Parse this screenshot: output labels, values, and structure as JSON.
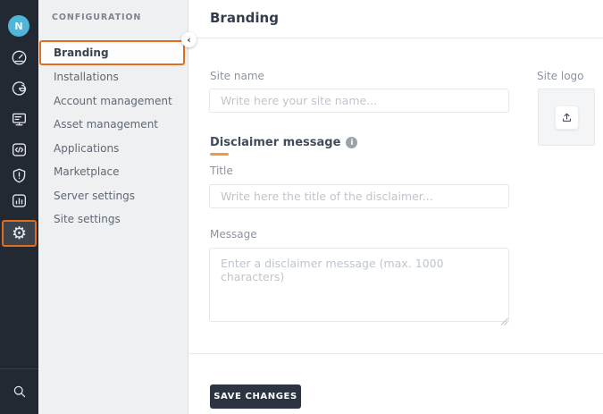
{
  "iconbar": {
    "avatar_label": "N",
    "icons": [
      {
        "name": "dashboard-gauge-icon"
      },
      {
        "name": "spiral-g-icon"
      },
      {
        "name": "monitoring-screen-icon"
      },
      {
        "name": "code-icon"
      },
      {
        "name": "security-shield-icon"
      },
      {
        "name": "reports-chart-icon"
      },
      {
        "name": "settings-gear-icon",
        "selected": true
      },
      {
        "name": "search-icon"
      }
    ],
    "gear_glyph": "⚙"
  },
  "sidebar": {
    "section_title": "CONFIGURATION",
    "collapse_glyph": "‹",
    "items": [
      {
        "label": "Branding",
        "selected": true
      },
      {
        "label": "Installations"
      },
      {
        "label": "Account management"
      },
      {
        "label": "Asset management"
      },
      {
        "label": "Applications"
      },
      {
        "label": "Marketplace"
      },
      {
        "label": "Server settings"
      },
      {
        "label": "Site settings"
      }
    ]
  },
  "main": {
    "title": "Branding",
    "site_name": {
      "label": "Site name",
      "placeholder": "Write here your site name..."
    },
    "site_logo": {
      "label": "Site logo"
    },
    "disclaimer": {
      "heading": "Disclaimer message",
      "info_glyph": "i"
    },
    "title_field": {
      "label": "Title",
      "placeholder": "Write here the title of the disclaimer..."
    },
    "message_field": {
      "label": "Message",
      "placeholder": "Enter a disclaimer message (max. 1000 characters)"
    },
    "save_button_label": "SAVE CHANGES"
  },
  "colors": {
    "accent_orange": "#e06e1d",
    "underline_orange": "#f19c3b",
    "rail_dark": "#232932",
    "avatar_blue": "#4fb5d9",
    "button_dark": "#2d3441",
    "sidebar_gray": "#eef0f2"
  }
}
